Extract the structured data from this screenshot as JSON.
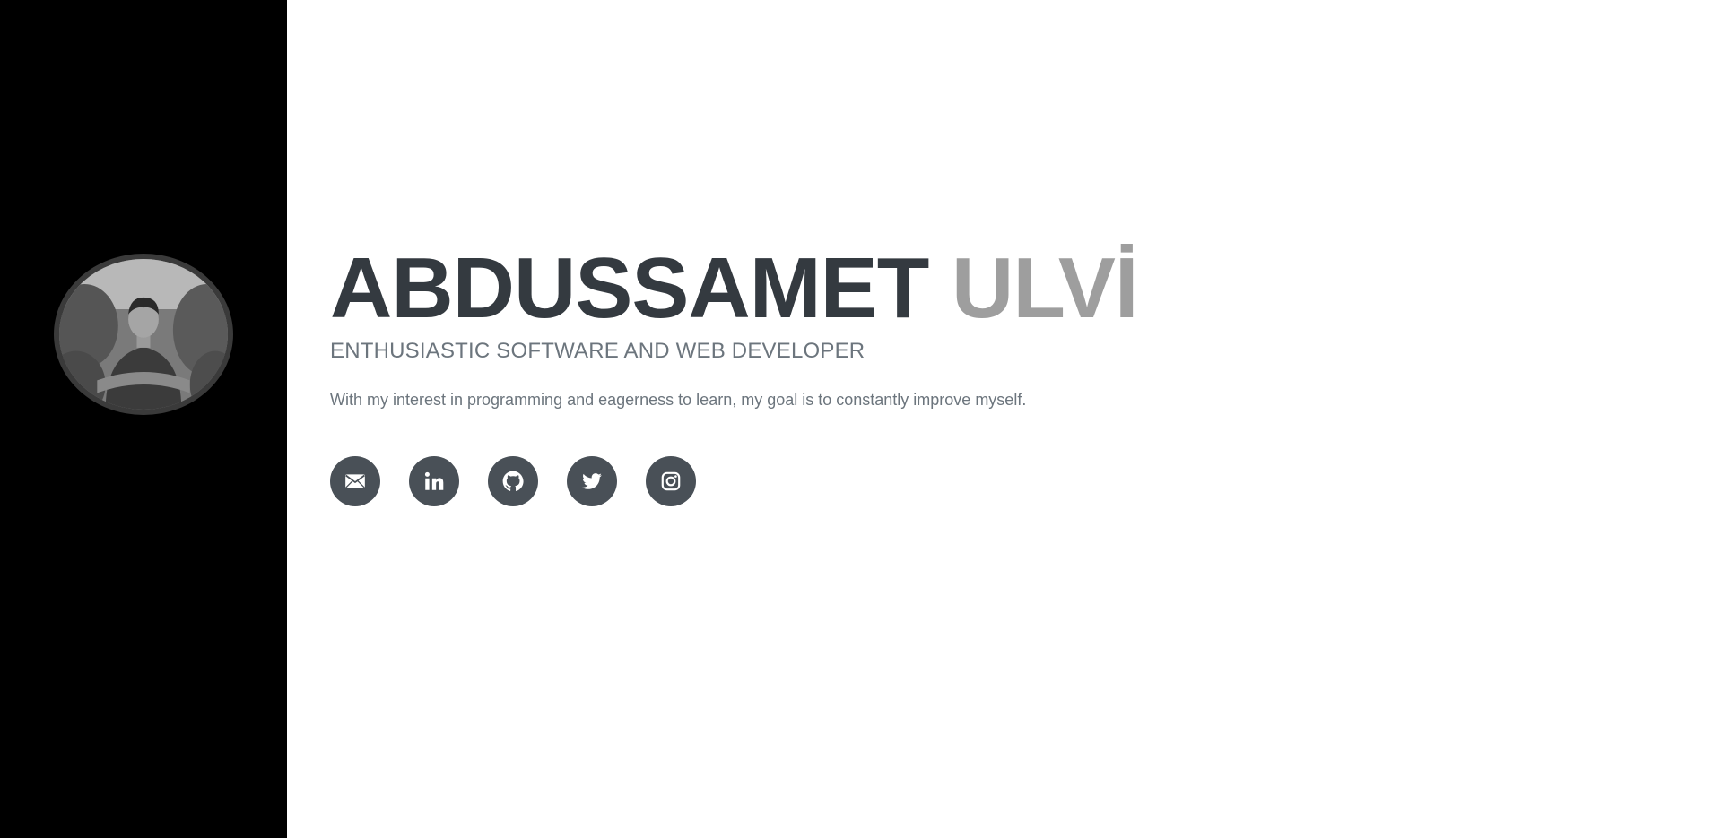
{
  "sidebar": {
    "avatar_icon": "profile-photo"
  },
  "hero": {
    "first_name": "ABDUSSAMET",
    "last_name": "ULVİ",
    "subtitle": "ENTHUSIASTIC SOFTWARE AND WEB DEVELOPER",
    "tagline": "With my interest in programming and eagerness to learn, my goal is to constantly improve myself."
  },
  "social": [
    {
      "icon": "envelope-icon"
    },
    {
      "icon": "linkedin-icon"
    },
    {
      "icon": "github-icon"
    },
    {
      "icon": "twitter-icon"
    },
    {
      "icon": "instagram-icon"
    }
  ],
  "colors": {
    "sidebar_bg": "#000000",
    "name_dark": "#343a40",
    "name_light": "#9e9e9e",
    "muted_text": "#6c757d",
    "social_bg": "#495057"
  }
}
